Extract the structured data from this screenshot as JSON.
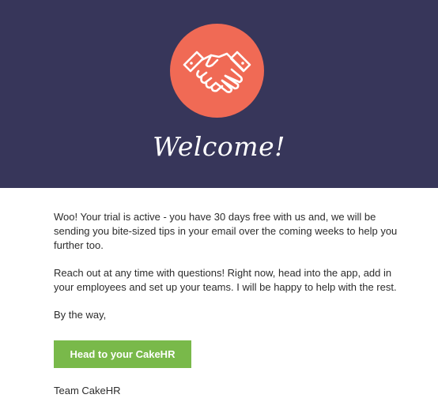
{
  "hero": {
    "background_color": "#37365a",
    "badge_color": "#f06a55",
    "icon": "handshake-icon",
    "title": "Welcome!"
  },
  "body": {
    "paragraphs": [
      "Woo! Your trial is active - you have 30 days free with us and, we will be sending you bite-sized tips in your email over the coming weeks to help you further too.",
      "Reach out at any time with questions! Right now, head into the app, add in your employees and set up your teams. I will be happy to help with the rest.",
      "By the way,"
    ],
    "cta_label": "Head to your CakeHR",
    "cta_color": "#79b94a",
    "signoff": "Team CakeHR"
  }
}
